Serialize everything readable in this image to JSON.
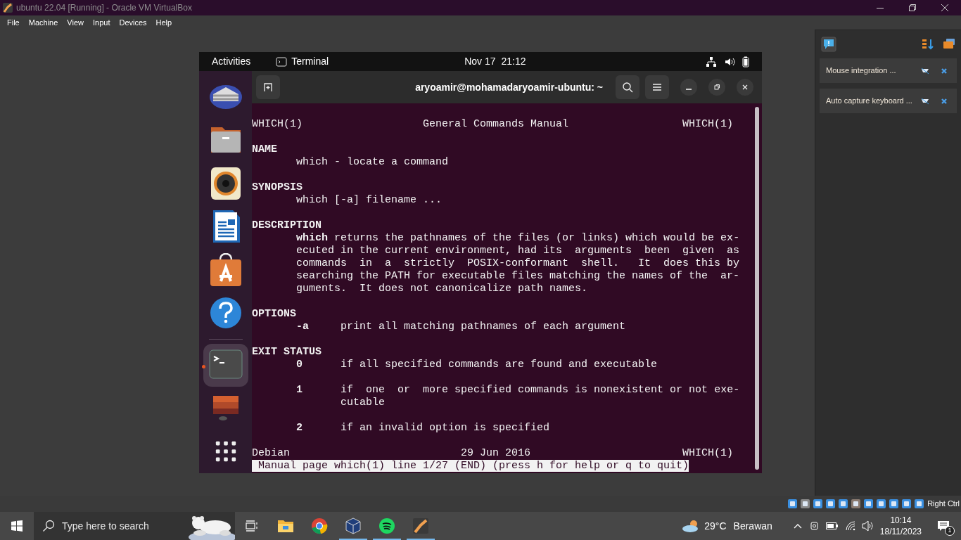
{
  "window": {
    "title": "ubuntu 22.04 [Running] - Oracle VM VirtualBox"
  },
  "menu": [
    "File",
    "Machine",
    "View",
    "Input",
    "Devices",
    "Help"
  ],
  "guest": {
    "top_bar": {
      "activities": "Activities",
      "app": "Terminal",
      "date": "Nov 17",
      "time": "21:12"
    },
    "dock": [
      {
        "kind": "thunderbird",
        "running": false
      },
      {
        "kind": "files",
        "running": false
      },
      {
        "kind": "rhythmbox",
        "running": false
      },
      {
        "kind": "writer",
        "running": false
      },
      {
        "kind": "software",
        "running": false
      },
      {
        "kind": "help",
        "running": false
      },
      {
        "kind": "separator"
      },
      {
        "kind": "terminal",
        "running": true
      },
      {
        "kind": "trash",
        "running": false
      },
      {
        "kind": "apps",
        "running": false
      }
    ],
    "terminal": {
      "title": "aryoamir@mohamadaryoamir-ubuntu: ~",
      "blocks": [
        [
          "WHICH(1)                   General Commands Manual                  WHICH(1)"
        ],
        [
          "**NAME**",
          "       which - locate a command"
        ],
        [
          "**SYNOPSIS**",
          "       which [-a] filename ..."
        ],
        [
          "**DESCRIPTION**",
          "       **which** returns the pathnames of the files (or links) which would be ex-",
          "       ecuted in the current environment, had its  arguments  been  given  as",
          "       commands  in  a  strictly  POSIX-conformant  shell.   It  does this by",
          "       searching the PATH for executable files matching the names of the  ar-",
          "       guments.  It does not canonicalize path names."
        ],
        [
          "**OPTIONS**",
          "       **-a**     print all matching pathnames of each argument"
        ],
        [
          "**EXIT STATUS**",
          "       **0**      if all specified commands are found and executable"
        ],
        [
          "       **1**      if  one  or  more specified commands is nonexistent or not exe-",
          "              cutable"
        ],
        [
          "       **2**      if an invalid option is specified"
        ],
        [
          "Debian                           29 Jun 2016                        WHICH(1)"
        ]
      ],
      "status_line": " Manual page which(1) line 1/27 (END) (press h for help or q to quit)"
    }
  },
  "notifications": [
    {
      "text": "Mouse integration ..."
    },
    {
      "text": "Auto capture keyboard ..."
    }
  ],
  "host_key": "Right Ctrl",
  "taskbar": {
    "search_placeholder": "Type here to search",
    "apps": [
      {
        "kind": "files",
        "running": false
      },
      {
        "kind": "chrome",
        "running": false
      },
      {
        "kind": "virtualbox",
        "running": true
      },
      {
        "kind": "spotify",
        "running": true
      },
      {
        "kind": "vm",
        "running": true
      }
    ],
    "weather": {
      "temp": "29°C",
      "condition": "Berawan"
    },
    "time": "10:14",
    "date": "18/11/2023",
    "notification_count": "1"
  }
}
